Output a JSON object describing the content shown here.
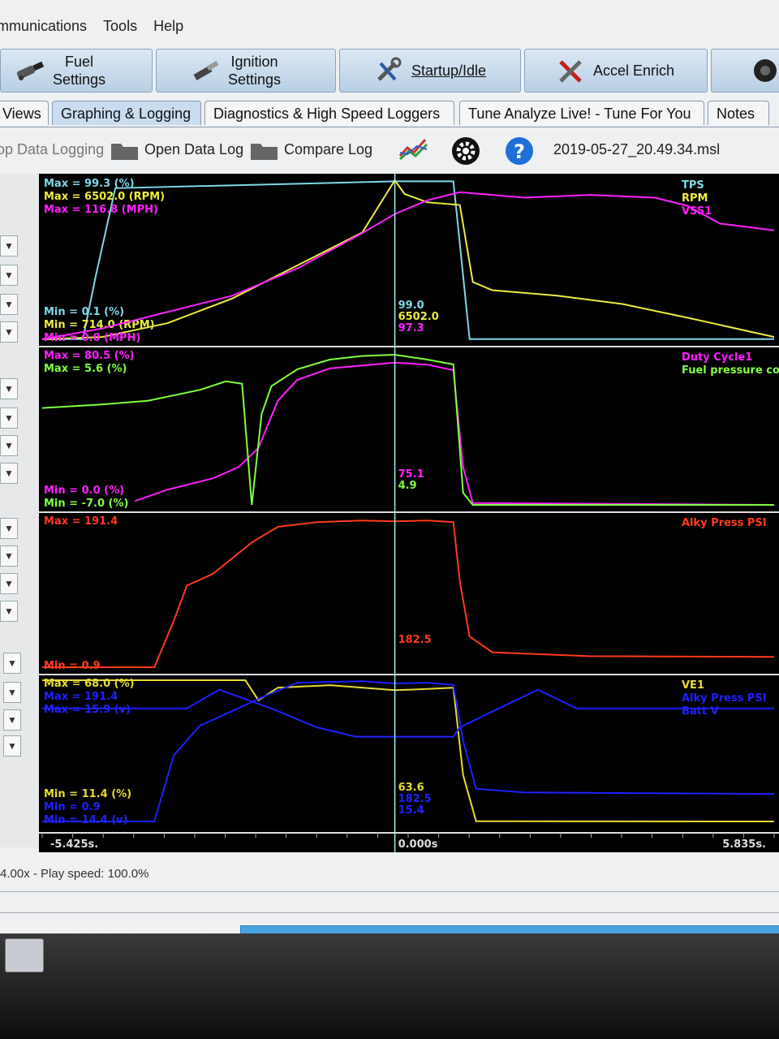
{
  "menu": [
    "mmunications",
    "Tools",
    "Help"
  ],
  "toolbar": {
    "fuel": "Fuel\nSettings",
    "ignition": "Ignition\nSettings",
    "startup": "Startup/Idle",
    "accel": "Accel Enrich"
  },
  "tabs": [
    "Views",
    "Graphing & Logging",
    "Diagnostics & High Speed Loggers",
    "Tune Analyze Live! - Tune For You",
    "Notes"
  ],
  "active_tab": "Graphing & Logging",
  "actions": {
    "stop_logging": "op Data Logging",
    "open_log": "Open Data Log",
    "compare_log": "Compare Log",
    "log_file": "2019-05-27_20.49.34.msl"
  },
  "status_text": "4.00x - Play speed: 100.0%",
  "timeline": {
    "left": "-5.425s.",
    "center": "0.000s",
    "right": "5.835s."
  },
  "colors": {
    "tps": "#7fd8e8",
    "rpm": "#ecec40",
    "vss": "#ff20ff",
    "fuel_pressure": "#80ff40",
    "alky": "#ff3a1a",
    "ve": "#e6dc30",
    "blue": "#2020ff"
  },
  "chart_data": [
    {
      "type": "line",
      "series": [
        {
          "name": "TPS",
          "max": "Max = 99.3 (%)",
          "min": "Min = 0.1 (%)",
          "cursor": "99.0",
          "color": "#7fd8e8",
          "t": [
            -5.425,
            -4.8,
            -4.6,
            -4.3,
            0,
            0.9,
            1.0,
            1.15,
            5.835
          ],
          "v": [
            0.1,
            0.1,
            40,
            95,
            99.3,
            99.3,
            60,
            0.1,
            0.1
          ]
        },
        {
          "name": "RPM",
          "max": "Max = 6502.0 (RPM)",
          "min": "Min = 714.0 (RPM)",
          "cursor": "6502.0",
          "color": "#ecec40",
          "t": [
            -5.425,
            -4.5,
            -3.5,
            -2.5,
            -1.5,
            -0.5,
            0,
            0.15,
            0.5,
            1.0,
            1.2,
            1.5,
            2.5,
            3.5,
            4.5,
            5.835
          ],
          "v": [
            714,
            800,
            1300,
            2200,
            3400,
            4600,
            6502,
            6000,
            5700,
            5600,
            2800,
            2500,
            2300,
            2000,
            1500,
            800
          ]
        },
        {
          "name": "VSS1",
          "max": "Max = 116.8 (MPH)",
          "min": "Min = 0.0 (MPH)",
          "cursor": "97.3",
          "color": "#ff20ff",
          "t": [
            -5.425,
            -4.5,
            -3.5,
            -2.5,
            -1.5,
            -0.5,
            0,
            0.5,
            1.0,
            2.0,
            3.0,
            4.0,
            4.5,
            5.0,
            5.835
          ],
          "v": [
            0,
            8,
            20,
            32,
            52,
            78,
            92,
            102,
            108,
            104,
            106,
            104,
            98,
            85,
            80
          ]
        }
      ]
    },
    {
      "type": "line",
      "series": [
        {
          "name": "Duty Cycle1",
          "max": "Max = 80.5 (%)",
          "min": "Min = 0.0 (%)",
          "cursor": "75.1",
          "color": "#ff20ff",
          "t": [
            -5.425,
            -4.0,
            -3.5,
            -2.8,
            -2.4,
            -2.1,
            -1.8,
            -1.5,
            -1.0,
            0,
            0.5,
            0.9,
            1.05,
            1.2,
            5.835
          ],
          "v": [
            null,
            2,
            8,
            14,
            20,
            30,
            55,
            66,
            72,
            75,
            74,
            71,
            20,
            1,
            0
          ]
        },
        {
          "name": "Fuel pressure co",
          "max": "Max = 5.6 (%)",
          "min": "Min = -7.0 (%)",
          "cursor": "4.9",
          "color": "#80ff40",
          "t": [
            -5.425,
            -4.5,
            -3.8,
            -3.0,
            -2.6,
            -2.35,
            -2.2,
            -2.05,
            -1.9,
            -1.5,
            -1.0,
            -0.5,
            0,
            0.5,
            0.9,
            1.05,
            1.2,
            5.835
          ],
          "v": [
            1.0,
            1.3,
            1.6,
            2.5,
            3.2,
            3.0,
            -7.0,
            0.5,
            2.8,
            4.2,
            5.0,
            5.3,
            5.4,
            5.0,
            4.6,
            -6.0,
            -7.0,
            -7.0
          ]
        }
      ]
    },
    {
      "type": "line",
      "series": [
        {
          "name": "Alky Press PSI",
          "max": "Max = 191.4",
          "min": "Min = 0.9",
          "cursor": "182.5",
          "color": "#ff3a1a",
          "t": [
            -5.425,
            -3.7,
            -3.4,
            -3.2,
            -2.8,
            -2.2,
            -1.8,
            -1.2,
            -0.5,
            0,
            0.5,
            0.9,
            1.0,
            1.15,
            1.5,
            3.0,
            5.835
          ],
          "v": [
            0.9,
            0.9,
            60,
            105,
            120,
            160,
            180,
            186,
            188,
            187,
            188,
            186,
            110,
            40,
            20,
            15,
            14
          ]
        }
      ]
    },
    {
      "type": "line",
      "series": [
        {
          "name": "VE1",
          "max": "Max = 68.0 (%)",
          "min": "Min = 11.4 (%)",
          "cursor": "63.6",
          "color": "#e6dc30",
          "t": [
            -5.425,
            -2.3,
            -2.1,
            -1.8,
            -1.0,
            0,
            0.5,
            0.9,
            1.05,
            1.25,
            5.835
          ],
          "v": [
            68,
            68,
            60,
            65,
            66,
            64,
            64.5,
            65,
            30,
            11.5,
            11.4
          ]
        },
        {
          "name": "Alky Press PSI",
          "max": "Max = 191.4",
          "min": "Min = 0.9",
          "cursor": "182.5",
          "color": "#2020ff",
          "t": [
            -5.425,
            -3.7,
            -3.4,
            -3.0,
            -2.5,
            -2.0,
            -1.5,
            -0.5,
            0,
            0.5,
            0.9,
            1.05,
            1.25,
            2.0,
            5.835
          ],
          "v": [
            0.9,
            0.9,
            90,
            130,
            150,
            170,
            188,
            190,
            187,
            188,
            185,
            110,
            45,
            40,
            38
          ]
        },
        {
          "name": "Batt V",
          "max": "Max = 15.9 (v)",
          "min": "Min = 14.4 (v)",
          "cursor": "15.4",
          "color": "#2020ff",
          "t": [
            -5.425,
            -3.2,
            -2.7,
            -1.9,
            -1.2,
            -0.6,
            0,
            0.5,
            0.9,
            1.0,
            1.3,
            1.6,
            2.2,
            2.8,
            3.6,
            5.835
          ],
          "v": [
            15.6,
            15.6,
            15.8,
            15.6,
            15.4,
            15.3,
            15.3,
            15.3,
            15.3,
            15.4,
            15.5,
            15.6,
            15.8,
            15.6,
            15.6,
            15.6
          ]
        }
      ]
    }
  ]
}
